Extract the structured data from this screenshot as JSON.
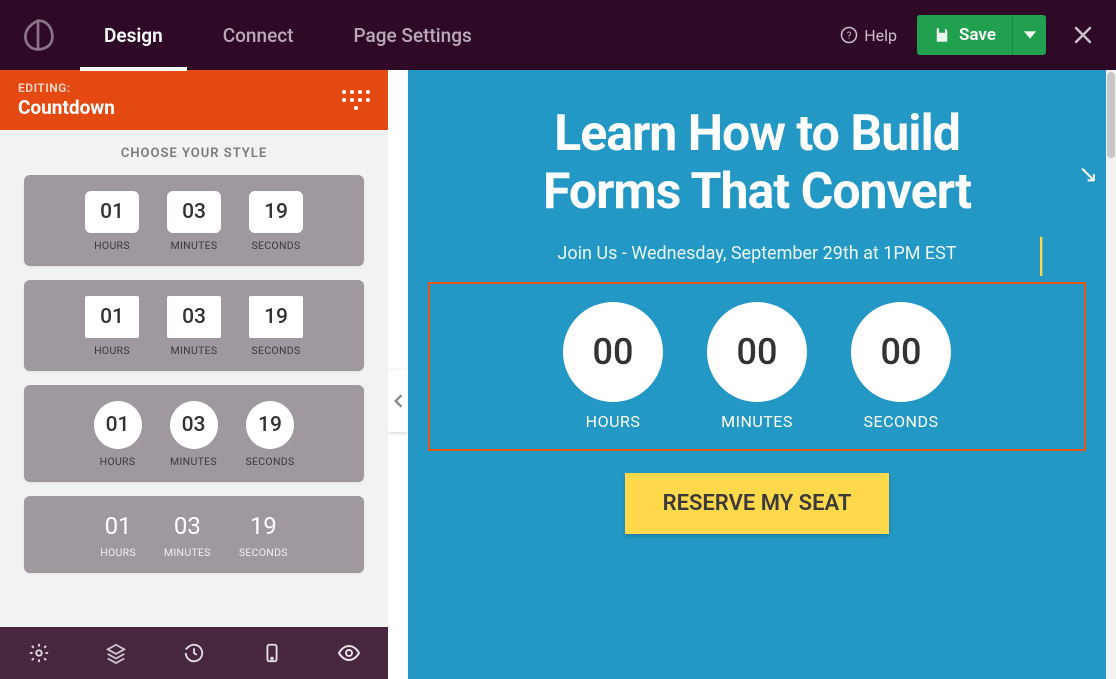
{
  "topbar": {
    "tabs": [
      "Design",
      "Connect",
      "Page Settings"
    ],
    "active_tab_index": 0,
    "help_label": "Help",
    "save_label": "Save"
  },
  "sidebar": {
    "editing_label": "EDITING:",
    "editing_title": "Countdown",
    "section_title": "CHOOSE YOUR STYLE",
    "styles": [
      {
        "hours": "01",
        "minutes": "03",
        "seconds": "19",
        "hours_label": "HOURS",
        "minutes_label": "MINUTES",
        "seconds_label": "SECONDS"
      },
      {
        "hours": "01",
        "minutes": "03",
        "seconds": "19",
        "hours_label": "HOURS",
        "minutes_label": "MINUTES",
        "seconds_label": "SECONDS"
      },
      {
        "hours": "01",
        "minutes": "03",
        "seconds": "19",
        "hours_label": "HOURS",
        "minutes_label": "MINUTES",
        "seconds_label": "SECONDS"
      },
      {
        "hours": "01",
        "minutes": "03",
        "seconds": "19",
        "hours_label": "HOURS",
        "minutes_label": "MINUTES",
        "seconds_label": "SECONDS"
      }
    ]
  },
  "canvas": {
    "headline_line1": "Learn How to Build",
    "headline_line2": "Forms That Convert",
    "subhead": "Join Us - Wednesday, September 29th at 1PM EST",
    "countdown": {
      "hours": "00",
      "minutes": "00",
      "seconds": "00",
      "hours_label": "HOURS",
      "minutes_label": "MINUTES",
      "seconds_label": "SECONDS"
    },
    "cta_label": "RESERVE MY SEAT"
  },
  "colors": {
    "accent_orange": "#e44912",
    "save_green": "#21a14f",
    "canvas_blue": "#2398c5",
    "cta_yellow": "#ffd84b"
  }
}
